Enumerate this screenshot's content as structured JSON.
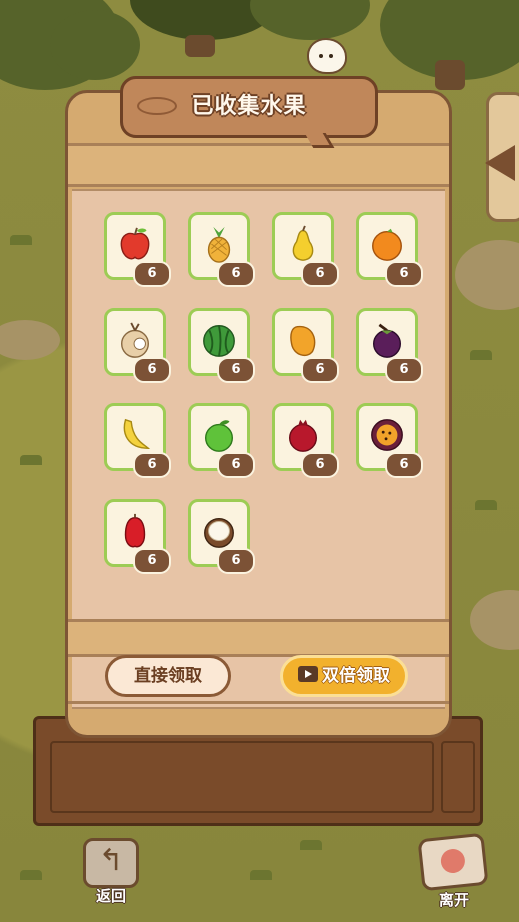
{
  "title": "已收集水果",
  "fruits": [
    {
      "name": "apple",
      "count": "6"
    },
    {
      "name": "pineapple",
      "count": "6"
    },
    {
      "name": "pear",
      "count": "6"
    },
    {
      "name": "orange",
      "count": "6"
    },
    {
      "name": "longan",
      "count": "6"
    },
    {
      "name": "watermelon",
      "count": "6"
    },
    {
      "name": "mango",
      "count": "6"
    },
    {
      "name": "mangosteen",
      "count": "6"
    },
    {
      "name": "banana",
      "count": "6"
    },
    {
      "name": "lime",
      "count": "6"
    },
    {
      "name": "pomegranate",
      "count": "6"
    },
    {
      "name": "passion-fruit",
      "count": "6"
    },
    {
      "name": "wax-apple",
      "count": "6"
    },
    {
      "name": "coconut",
      "count": "6"
    }
  ],
  "buttons": {
    "direct": "直接领取",
    "double": "双倍领取",
    "back": "返回",
    "leave": "离开"
  },
  "colors": {
    "card_border": "#9dcc55",
    "badge": "#7c5236",
    "double_button": "#f2b12d"
  }
}
